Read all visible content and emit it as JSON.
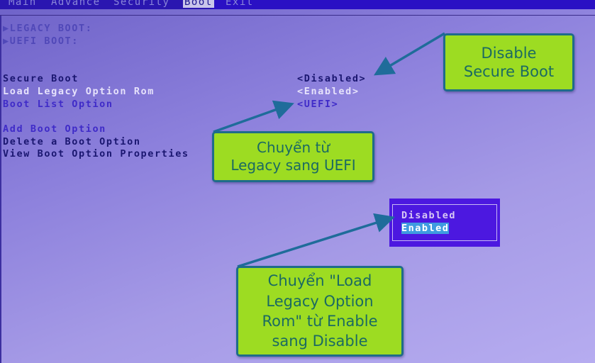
{
  "menubar": {
    "tabs": [
      {
        "label": "Main"
      },
      {
        "label": "Advance"
      },
      {
        "label": "Security"
      },
      {
        "label": "Boot",
        "active": true
      },
      {
        "label": "Exit"
      }
    ]
  },
  "boot": {
    "groups": [
      {
        "label": "▶LEGACY BOOT:"
      },
      {
        "label": "▶UEFI BOOT:"
      }
    ],
    "settings": [
      {
        "label": "Secure Boot",
        "value": "<Disabled>"
      },
      {
        "label": "Load Legacy Option Rom",
        "value": "<Enabled>"
      },
      {
        "label": "Boot List Option",
        "value": "<UEFI>"
      }
    ],
    "actions": [
      {
        "label": "Add Boot Option"
      },
      {
        "label": "Delete a Boot Option"
      },
      {
        "label": "View Boot Option Properties"
      }
    ]
  },
  "popup": {
    "options": [
      "Disabled",
      "Enabled"
    ],
    "selected": "Enabled"
  },
  "annotations": {
    "secure_boot": "Disable\nSecure Boot",
    "boot_list": "Chuyển từ\nLegacy sang UEFI",
    "legacy_rom": "Chuyển \"Load\nLegacy Option\nRom\" từ Enable\nsang Disable"
  },
  "colors": {
    "callout_fill": "#9ddc22",
    "callout_border": "#1f6c8a",
    "arrow": "#1f6c9a",
    "menubar": "#2a16b0",
    "popup": "#4c18e0",
    "selection": "#3f9be0"
  }
}
